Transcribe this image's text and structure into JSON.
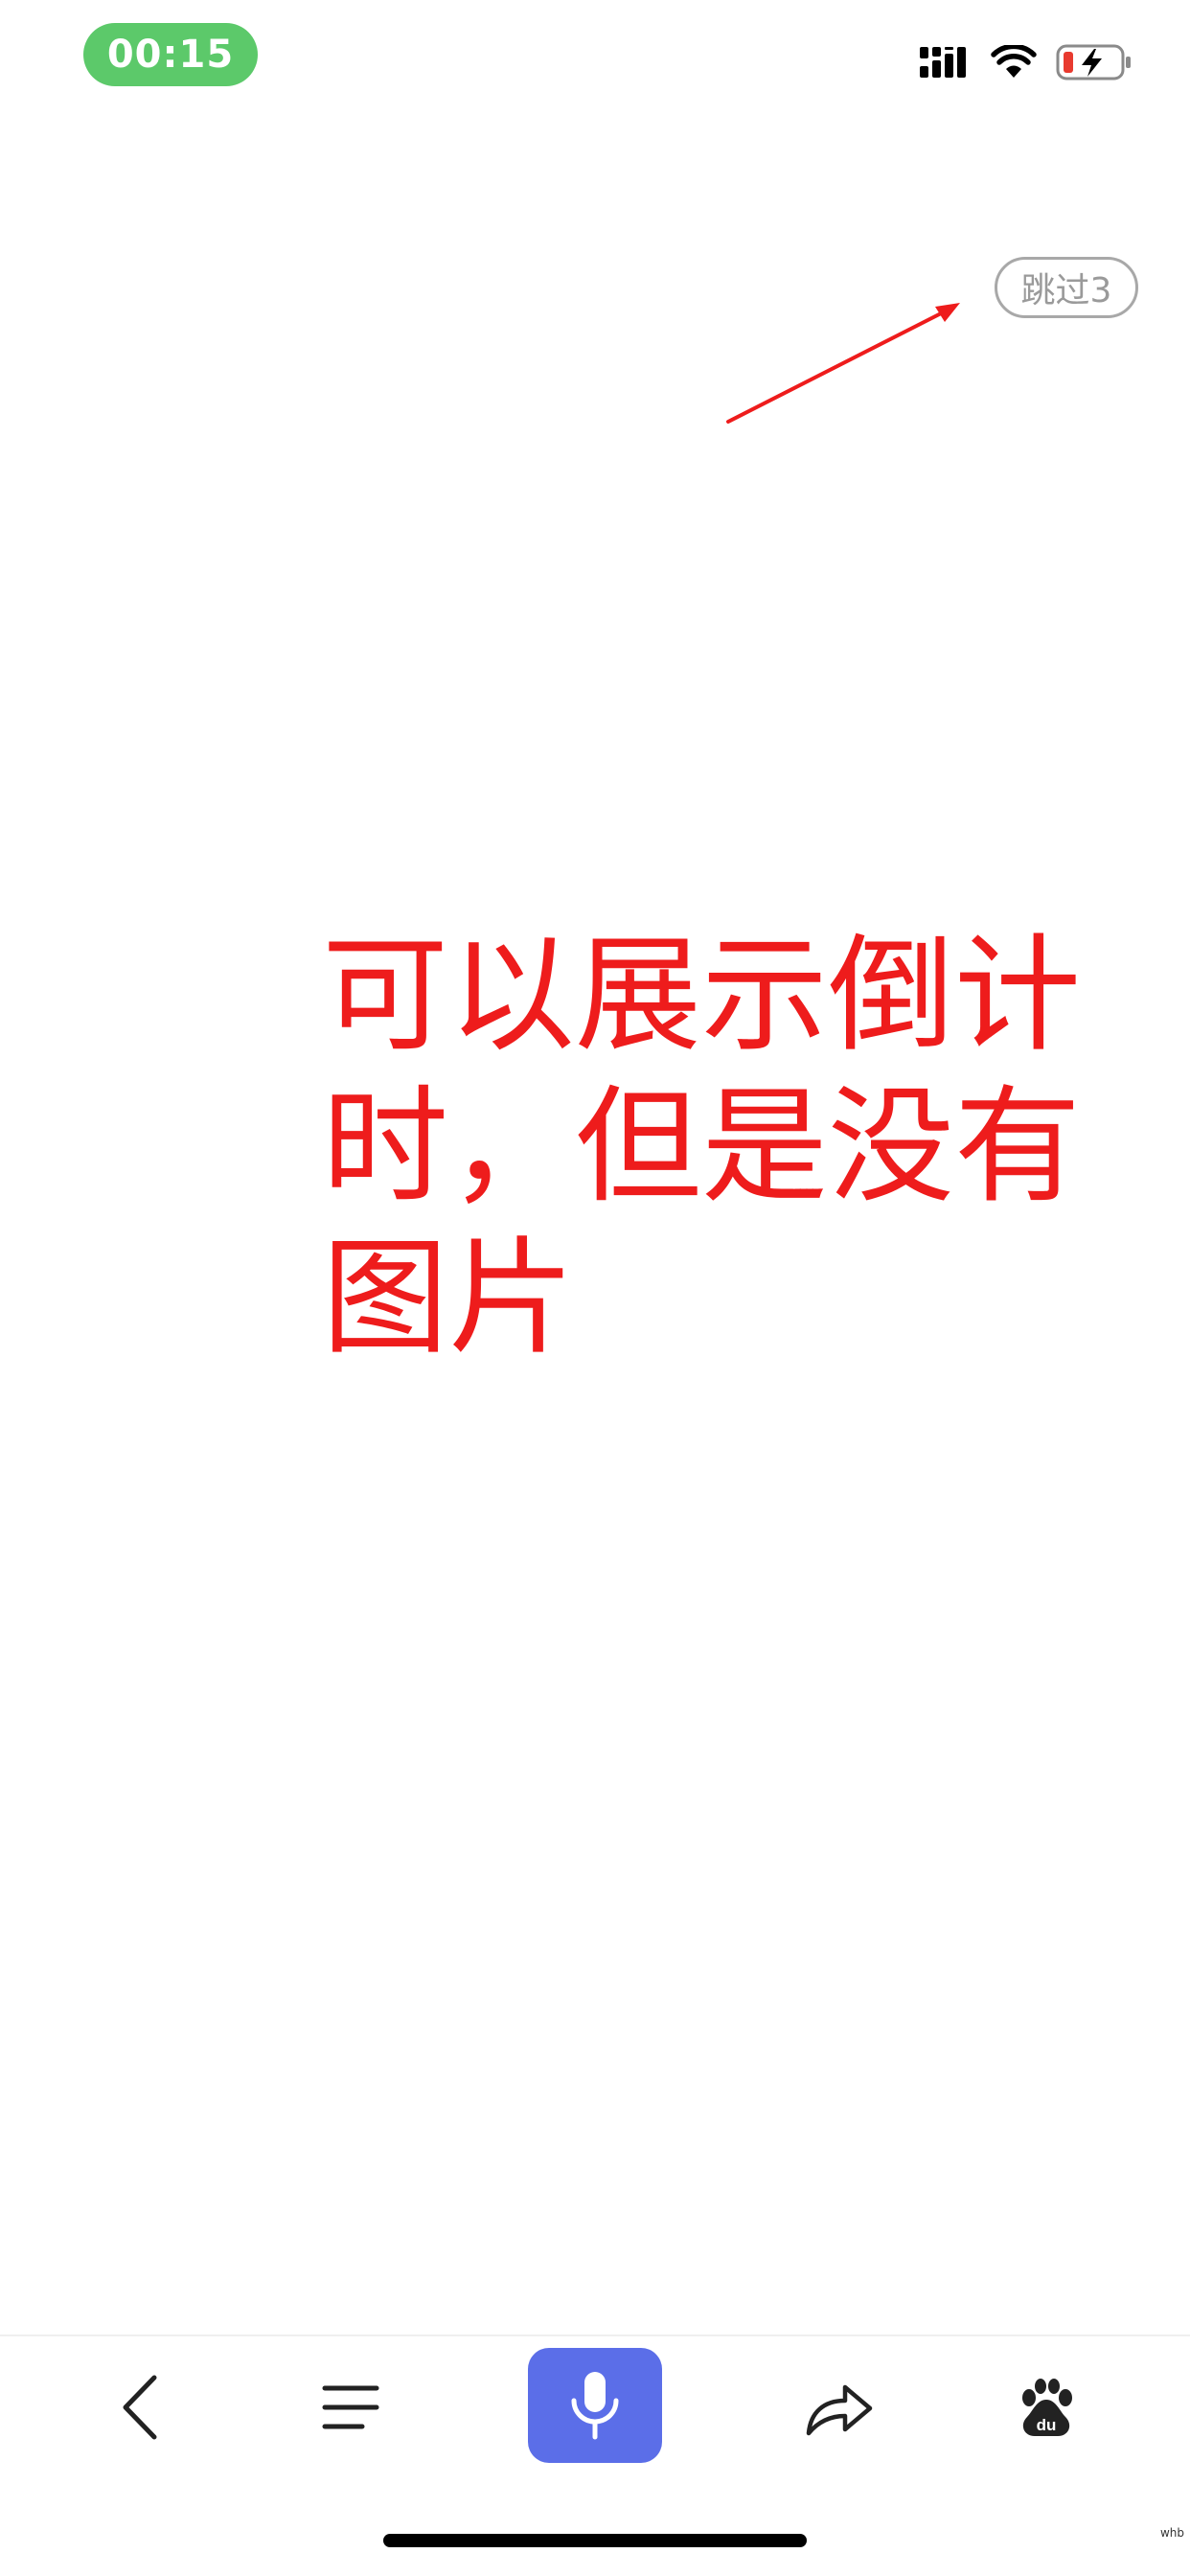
{
  "status_bar": {
    "time": "00:15",
    "time_pill_color": "#5cc96a",
    "icons": [
      "signal-icon",
      "wifi-icon",
      "battery-charging-icon"
    ],
    "battery_low_color": "#e83a2f"
  },
  "ad": {
    "skip_label": "跳过3"
  },
  "annotation": {
    "text": "可以展示倒计时，但是没有图片",
    "color": "#ee1c1c"
  },
  "toolbar": {
    "items": [
      {
        "name": "back",
        "icon": "chevron-left-icon"
      },
      {
        "name": "menu",
        "icon": "menu-icon"
      },
      {
        "name": "voice",
        "icon": "microphone-icon"
      },
      {
        "name": "share",
        "icon": "share-icon"
      },
      {
        "name": "home",
        "icon": "baidu-paw-icon"
      }
    ],
    "voice_bg_color": "#5b6ee8"
  },
  "watermark": "whb"
}
